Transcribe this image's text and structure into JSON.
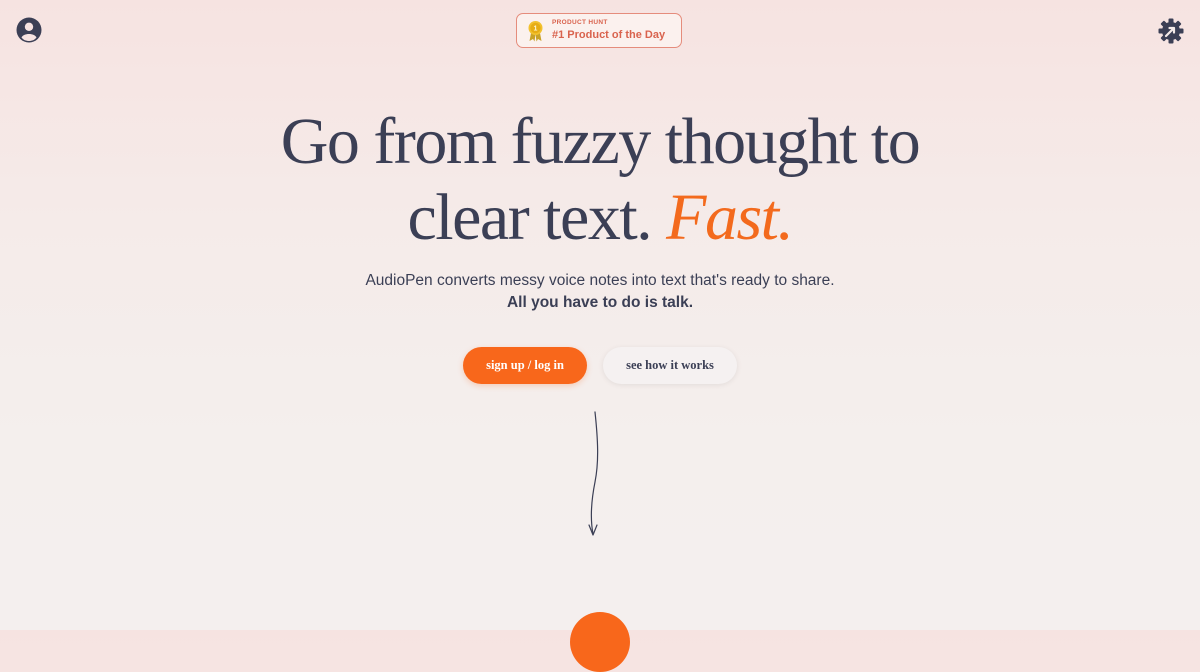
{
  "header": {
    "account_icon": "user-circle-icon",
    "settings_icon": "gear-icon",
    "badge": {
      "eyebrow": "PRODUCT HUNT",
      "title": "#1 Product of the Day",
      "icon": "medal-icon"
    }
  },
  "hero": {
    "headline_line1": "Go from fuzzy thought to",
    "headline_line2": "clear text.",
    "headline_accent": "Fast.",
    "subtitle": "AudioPen converts messy voice notes into text that's ready to share.",
    "subtitle_strong": "All you have to do is talk.",
    "primary_cta": "sign up / log in",
    "secondary_cta": "see how it works"
  },
  "colors": {
    "accent": "#f8671b",
    "text": "#3b3f55",
    "badge": "#d9634e"
  }
}
